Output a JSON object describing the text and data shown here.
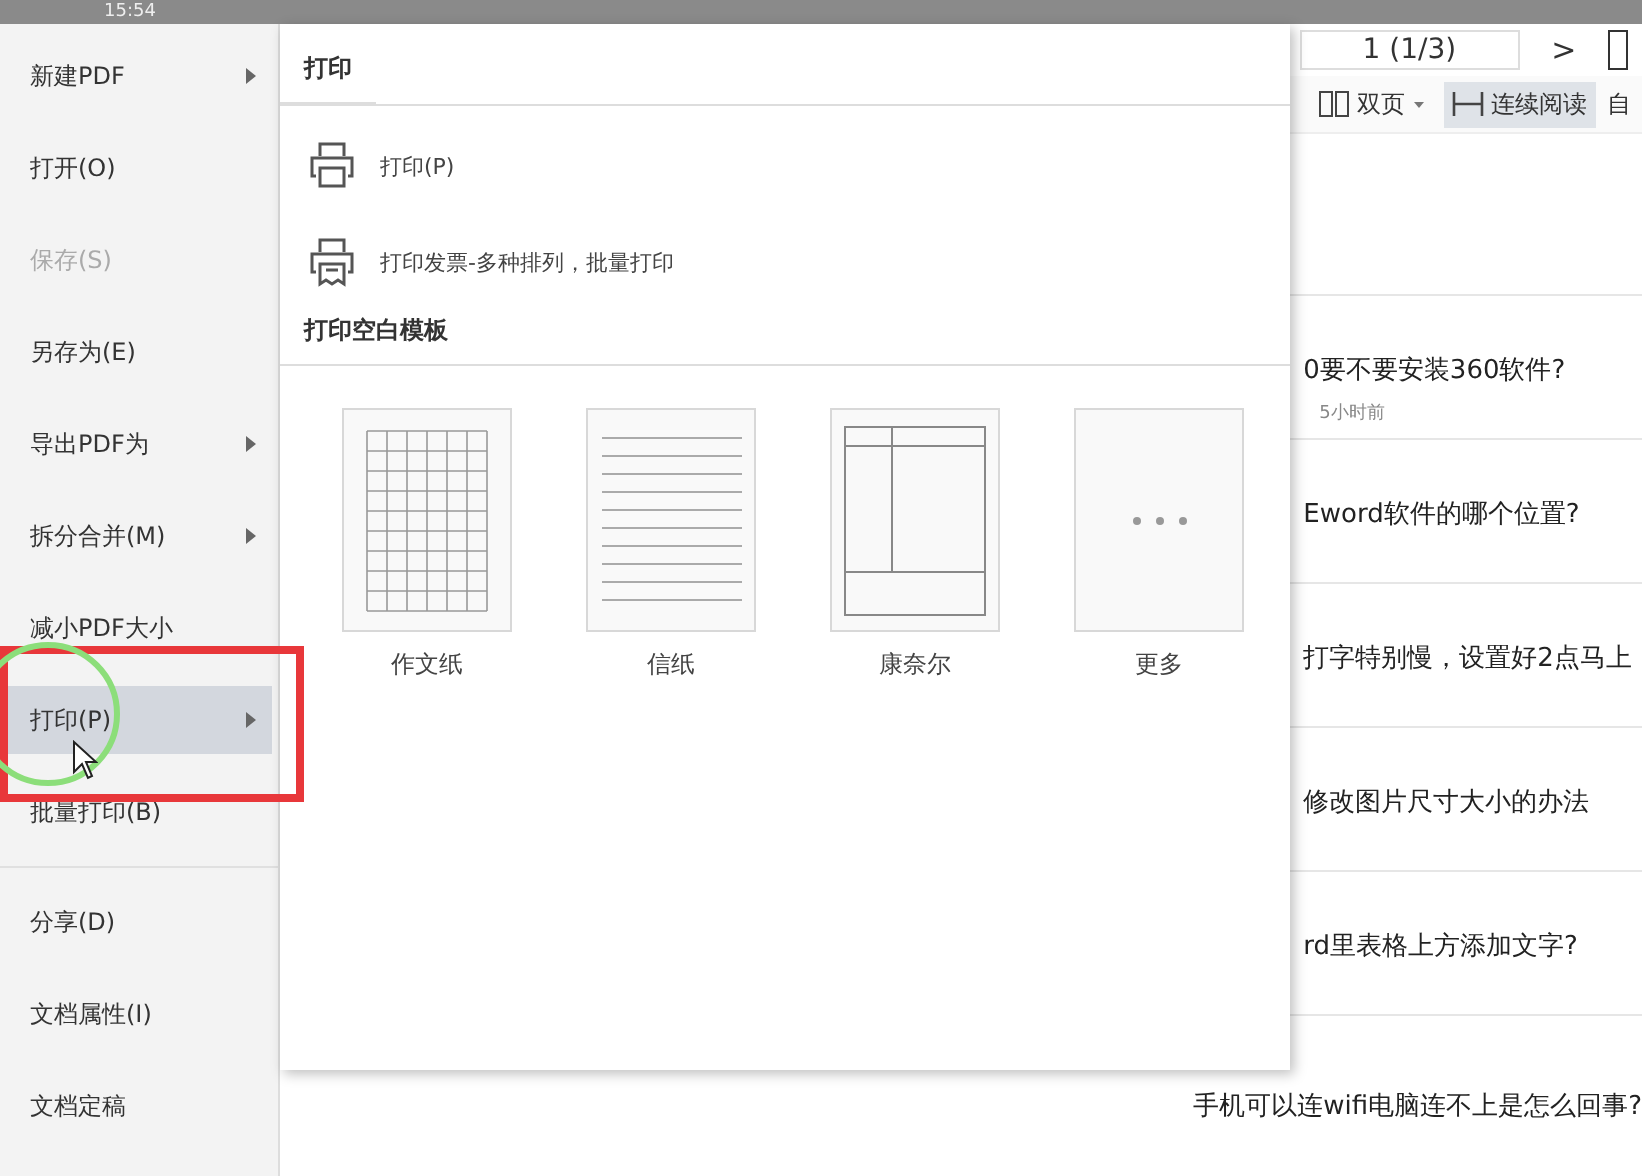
{
  "status_bar": {
    "time": "15:54"
  },
  "file_menu": {
    "items": [
      {
        "label": "新建PDF",
        "submenu": true,
        "disabled": false,
        "selected": false
      },
      {
        "label": "打开(O)",
        "submenu": false,
        "disabled": false,
        "selected": false
      },
      {
        "label": "保存(S)",
        "submenu": false,
        "disabled": true,
        "selected": false
      },
      {
        "label": "另存为(E)",
        "submenu": false,
        "disabled": false,
        "selected": false
      },
      {
        "label": "导出PDF为",
        "submenu": true,
        "disabled": false,
        "selected": false
      },
      {
        "label": "拆分合并(M)",
        "submenu": true,
        "disabled": false,
        "selected": false
      },
      {
        "label": "减小PDF大小",
        "submenu": false,
        "disabled": false,
        "selected": false
      },
      {
        "label": "打印(P)",
        "submenu": true,
        "disabled": false,
        "selected": true
      },
      {
        "label": "批量打印(B)",
        "submenu": false,
        "disabled": false,
        "selected": false,
        "divider_after": true
      },
      {
        "label": "分享(D)",
        "submenu": false,
        "disabled": false,
        "selected": false
      },
      {
        "label": "文档属性(I)",
        "submenu": false,
        "disabled": false,
        "selected": false
      },
      {
        "label": "文档定稿",
        "submenu": false,
        "disabled": false,
        "selected": false
      }
    ]
  },
  "print_submenu": {
    "title": "打印",
    "actions": [
      {
        "label": "打印(P)",
        "kind": "printer"
      },
      {
        "label": "打印发票-多种排列，批量打印",
        "kind": "invoice"
      }
    ],
    "templates_title": "打印空白模板",
    "templates": [
      {
        "label": "作文纸",
        "kind": "grid"
      },
      {
        "label": "信纸",
        "kind": "lines"
      },
      {
        "label": "康奈尔",
        "kind": "cornell"
      },
      {
        "label": "更多",
        "kind": "more"
      }
    ]
  },
  "toolbar": {
    "page_field": "1 (1/3)",
    "next": ">",
    "view_mode": "双页",
    "continuous": {
      "label": "连续阅读",
      "selected": true
    },
    "auto": "自"
  },
  "articles": [
    {
      "title": "0要不要安装360软件?",
      "meta": "5小时前"
    },
    {
      "title": "Eword软件的哪个位置?"
    },
    {
      "title": "打字特别慢，设置好2点马上"
    },
    {
      "title": "修改图片尺寸大小的办法"
    },
    {
      "title": "rd里表格上方添加文字?"
    },
    {
      "title": "手机可以连wifi电脑连不上是怎么回事?"
    }
  ]
}
